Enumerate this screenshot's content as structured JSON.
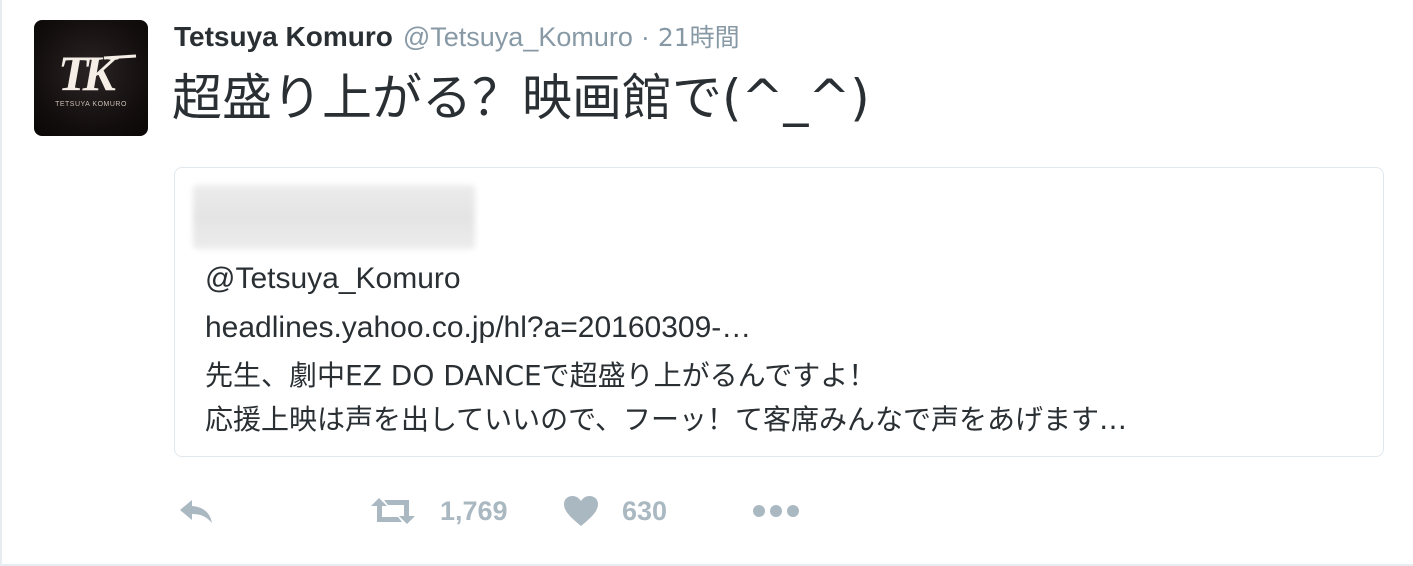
{
  "tweet": {
    "author": {
      "name": "Tetsuya Komuro",
      "handle": "@Tetsuya_Komuro",
      "avatar_label": "TETSUYA KOMURO"
    },
    "separator": "·",
    "time": "21時間",
    "text": "超盛り上がる？映画館で(^_^)",
    "quoted": {
      "mention": "@Tetsuya_Komuro",
      "link": "headlines.yahoo.co.jp/hl?a=20160309-…",
      "line1": "先生、劇中EZ DO DANCEで超盛り上がるんですよ！",
      "line2": "応援上映は声を出していいので、フーッ！て客席みんなで声をあげます…"
    },
    "actions": {
      "retweets": "1,769",
      "likes": "630"
    },
    "icons": {
      "reply": "reply-icon",
      "retweet": "retweet-icon",
      "like": "heart-icon",
      "more": "more-icon"
    },
    "colors": {
      "text": "#292f33",
      "meta": "#8899a6",
      "action": "#aab8c2",
      "border": "#e1e8ed"
    }
  }
}
